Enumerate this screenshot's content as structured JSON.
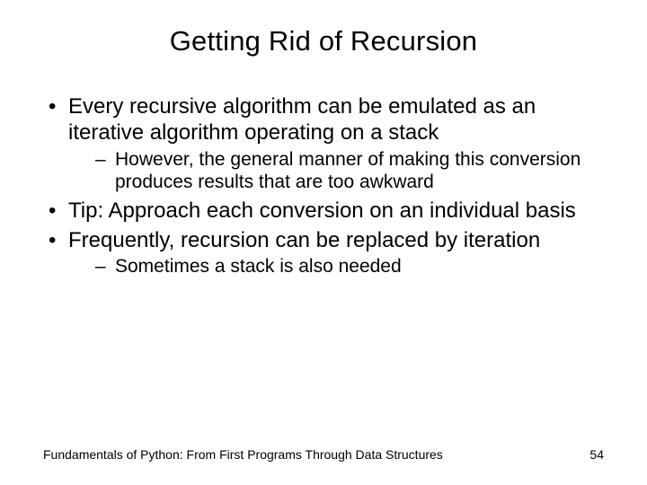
{
  "title": "Getting Rid of Recursion",
  "bullets": {
    "b0": "Every recursive algorithm can be emulated as an iterative algorithm operating on a stack",
    "b0_sub0": "However, the general manner of making this conversion produces results that are too awkward",
    "b1": "Tip: Approach each conversion on an individual basis",
    "b2": "Frequently, recursion can be replaced by iteration",
    "b2_sub0": "Sometimes a stack is also needed"
  },
  "footer": {
    "source": "Fundamentals of Python: From First Programs Through Data Structures",
    "page": "54"
  }
}
